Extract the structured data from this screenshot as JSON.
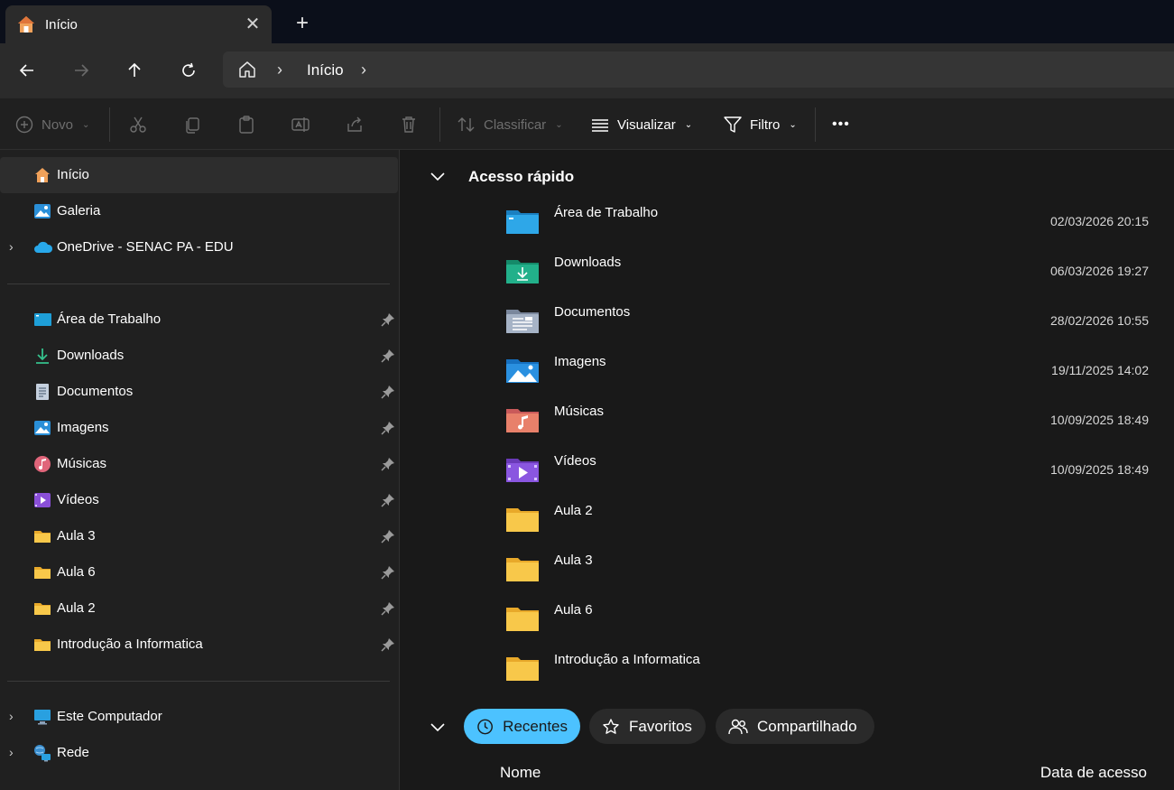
{
  "tab": {
    "title": "Início",
    "close": "✕",
    "new": "+"
  },
  "address": {
    "path": "Início"
  },
  "toolbar": {
    "new_label": "Novo",
    "sort_label": "Classificar",
    "view_label": "Visualizar",
    "filter_label": "Filtro",
    "more_label": "•••"
  },
  "sidebar": {
    "top": [
      {
        "label": "Início",
        "icon": "home-icon"
      },
      {
        "label": "Galeria",
        "icon": "gallery-icon"
      },
      {
        "label": "OneDrive - SENAC PA - EDU",
        "icon": "onedrive-icon"
      }
    ],
    "pinned": [
      {
        "label": "Área de Trabalho",
        "icon": "desktop-icon"
      },
      {
        "label": "Downloads",
        "icon": "download-icon"
      },
      {
        "label": "Documentos",
        "icon": "documents-icon"
      },
      {
        "label": "Imagens",
        "icon": "pictures-icon"
      },
      {
        "label": "Músicas",
        "icon": "music-icon"
      },
      {
        "label": "Vídeos",
        "icon": "videos-icon"
      },
      {
        "label": "Aula 3",
        "icon": "folder-icon"
      },
      {
        "label": "Aula 6",
        "icon": "folder-icon"
      },
      {
        "label": "Aula 2",
        "icon": "folder-icon"
      },
      {
        "label": "Introdução a Informatica",
        "icon": "folder-icon"
      }
    ],
    "bottom": [
      {
        "label": "Este Computador",
        "icon": "computer-icon"
      },
      {
        "label": "Rede",
        "icon": "network-icon"
      }
    ]
  },
  "quick_access": {
    "title": "Acesso rápido",
    "items": [
      {
        "name": "Área de Trabalho",
        "date": "02/03/2026 20:15",
        "icon": "desktop-folder-icon"
      },
      {
        "name": "Downloads",
        "date": "06/03/2026 19:27",
        "icon": "downloads-folder-icon"
      },
      {
        "name": "Documentos",
        "date": "28/02/2026 10:55",
        "icon": "documents-folder-icon"
      },
      {
        "name": "Imagens",
        "date": "19/11/2025 14:02",
        "icon": "pictures-folder-icon"
      },
      {
        "name": "Músicas",
        "date": "10/09/2025 18:49",
        "icon": "music-folder-icon"
      },
      {
        "name": "Vídeos",
        "date": "10/09/2025 18:49",
        "icon": "videos-folder-icon"
      },
      {
        "name": "Aula 2",
        "date": "",
        "icon": "folder-icon"
      },
      {
        "name": "Aula 3",
        "date": "",
        "icon": "folder-icon"
      },
      {
        "name": "Aula 6",
        "date": "",
        "icon": "folder-icon"
      },
      {
        "name": "Introdução a Informatica",
        "date": "",
        "icon": "folder-icon"
      }
    ]
  },
  "recent_tabs": {
    "recent": "Recentes",
    "favorites": "Favoritos",
    "shared": "Compartilhado"
  },
  "columns": {
    "name": "Nome",
    "access_date": "Data de acesso"
  },
  "colors": {
    "accent": "#4cc2ff",
    "folder": "#f8c84a"
  }
}
